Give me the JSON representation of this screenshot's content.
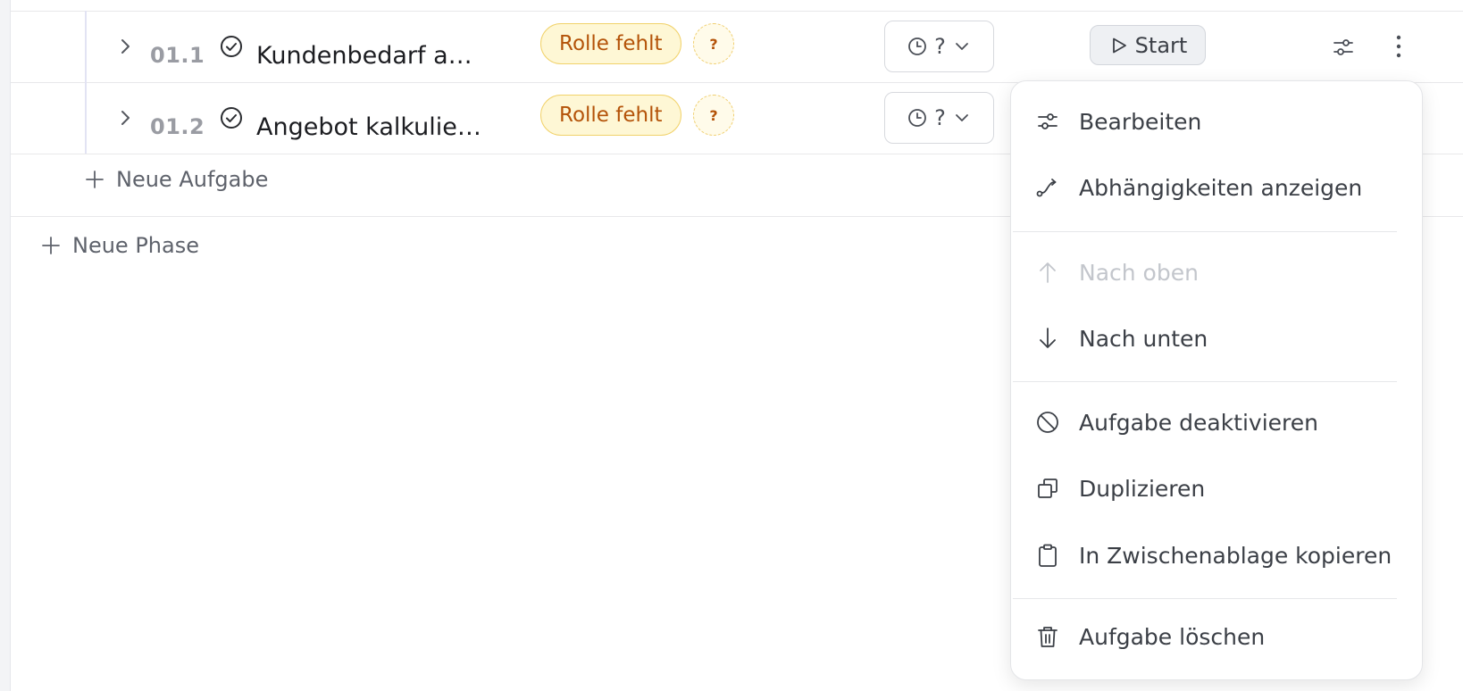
{
  "tasks": [
    {
      "number": "01.1",
      "title": "Kundenbedarf a…",
      "role_badge": "Rolle fehlt",
      "role_unknown": "?",
      "duration": "?",
      "start_label": "Start"
    },
    {
      "number": "01.2",
      "title": "Angebot kalkulie…",
      "role_badge": "Rolle fehlt",
      "role_unknown": "?",
      "duration": "?"
    }
  ],
  "add_task_label": "Neue Aufgabe",
  "add_phase_label": "Neue Phase",
  "context_menu": {
    "items": [
      {
        "label": "Bearbeiten",
        "icon": "sliders-icon",
        "disabled": false
      },
      {
        "label": "Abhängigkeiten anzeigen",
        "icon": "dependency-icon",
        "disabled": false
      },
      {
        "label": "Nach oben",
        "icon": "arrow-up-icon",
        "disabled": true
      },
      {
        "label": "Nach unten",
        "icon": "arrow-down-icon",
        "disabled": false
      },
      {
        "label": "Aufgabe deaktivieren",
        "icon": "ban-icon",
        "disabled": false
      },
      {
        "label": "Duplizieren",
        "icon": "duplicate-icon",
        "disabled": false
      },
      {
        "label": "In Zwischenablage kopieren",
        "icon": "clipboard-icon",
        "disabled": false
      },
      {
        "label": "Aufgabe löschen",
        "icon": "trash-icon",
        "disabled": false
      }
    ]
  },
  "colors": {
    "role_badge_bg": "#fef7d5",
    "role_badge_text": "#b45309",
    "disabled_text": "#c3c6cc"
  }
}
